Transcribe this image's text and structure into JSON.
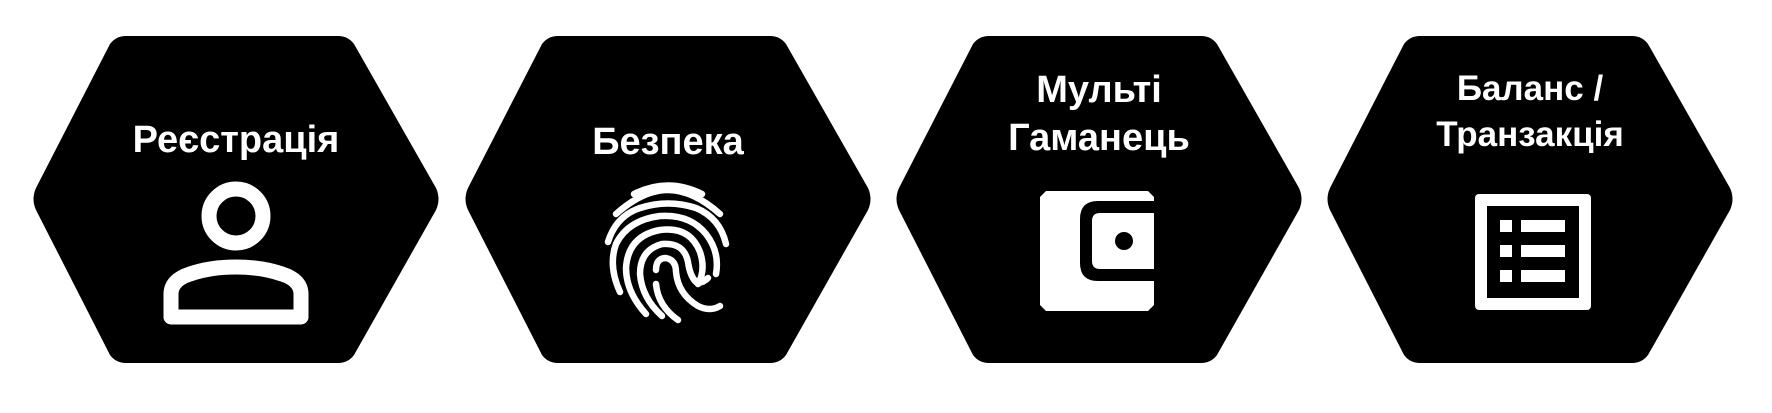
{
  "colors": {
    "hexagon_fill": "#000000",
    "text": "#ffffff",
    "icon": "#ffffff",
    "background": "#ffffff"
  },
  "hexagons": [
    {
      "title": "Реєстрація",
      "icon": "person-icon"
    },
    {
      "title": "Безпека",
      "icon": "fingerprint-icon"
    },
    {
      "title_lines": [
        "Мульті",
        "Гаманець"
      ],
      "icon": "wallet-icon"
    },
    {
      "title_lines": [
        "Баланс /",
        "Транзакція"
      ],
      "icon": "list-icon"
    }
  ]
}
